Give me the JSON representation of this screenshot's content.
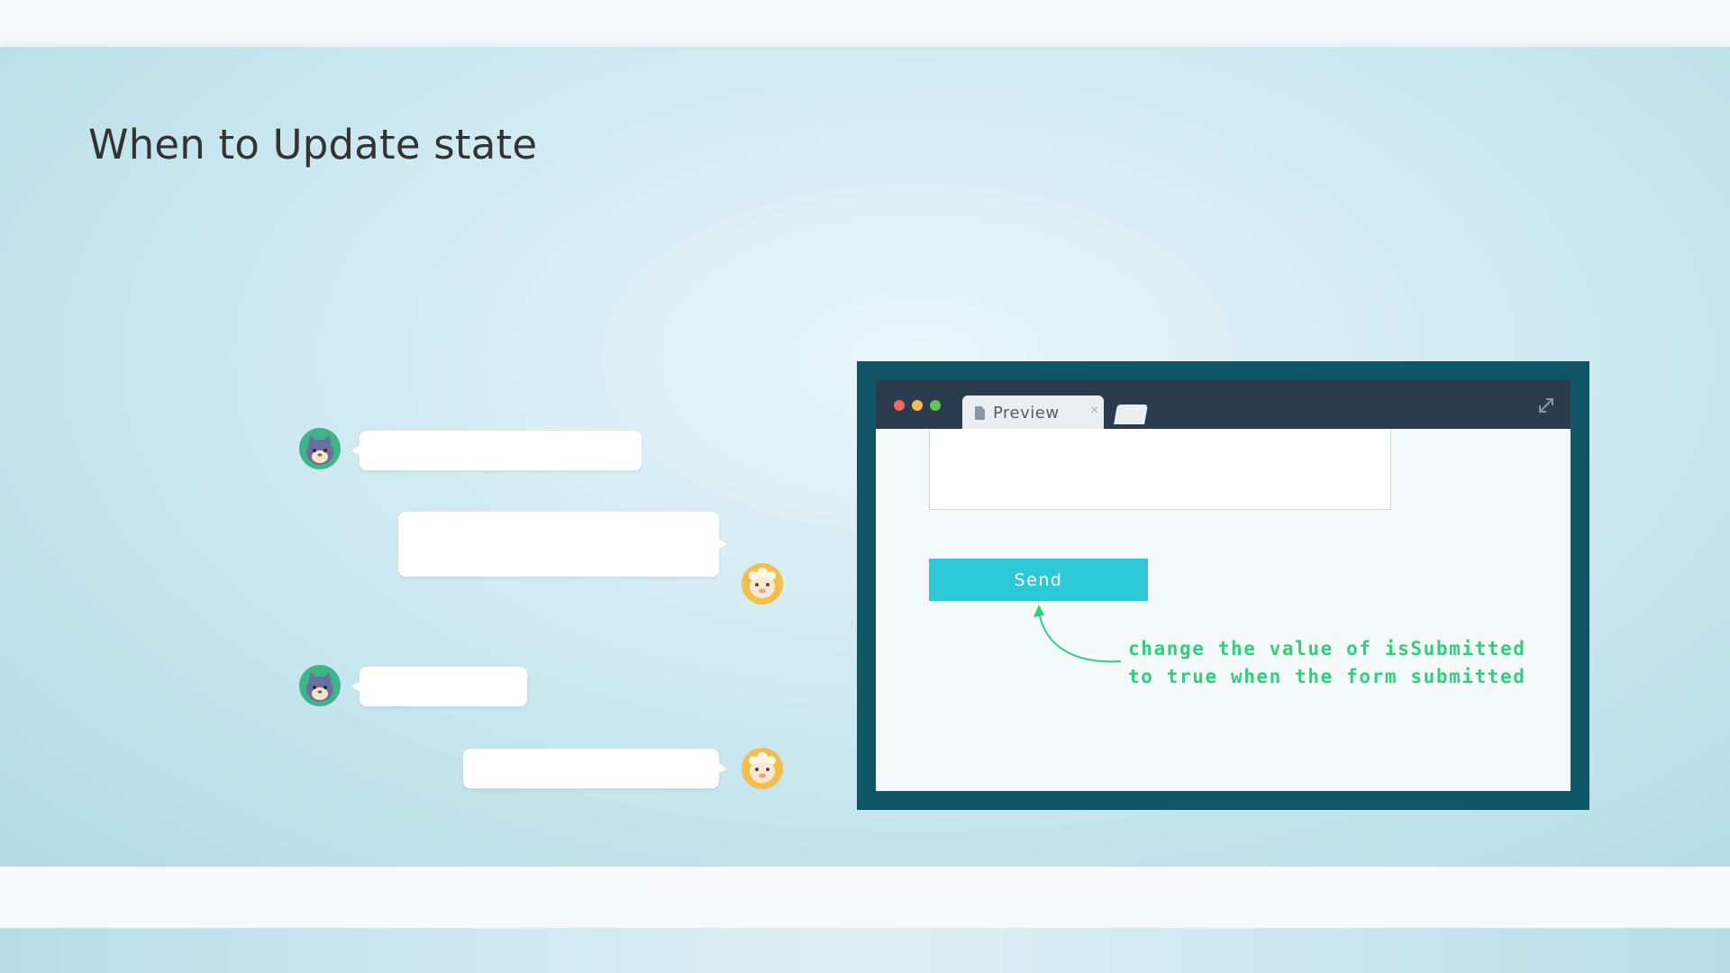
{
  "slide": {
    "title": "When to Update state"
  },
  "chat": {
    "avatars": [
      "cat-avatar-icon",
      "sheep-avatar-icon"
    ]
  },
  "browser": {
    "window_controls": {
      "close_color": "#ee6a5f",
      "minimize_color": "#f5bd4f",
      "maximize_color": "#61c554"
    },
    "tab_label": "Preview",
    "tab_close_glyph": "×",
    "send_button_label": "Send",
    "accent_color": "#2fc8d6"
  },
  "annotation": {
    "line1": "change the value of isSubmitted",
    "line2": "to true when the form submitted",
    "color": "#2fcf7e"
  }
}
